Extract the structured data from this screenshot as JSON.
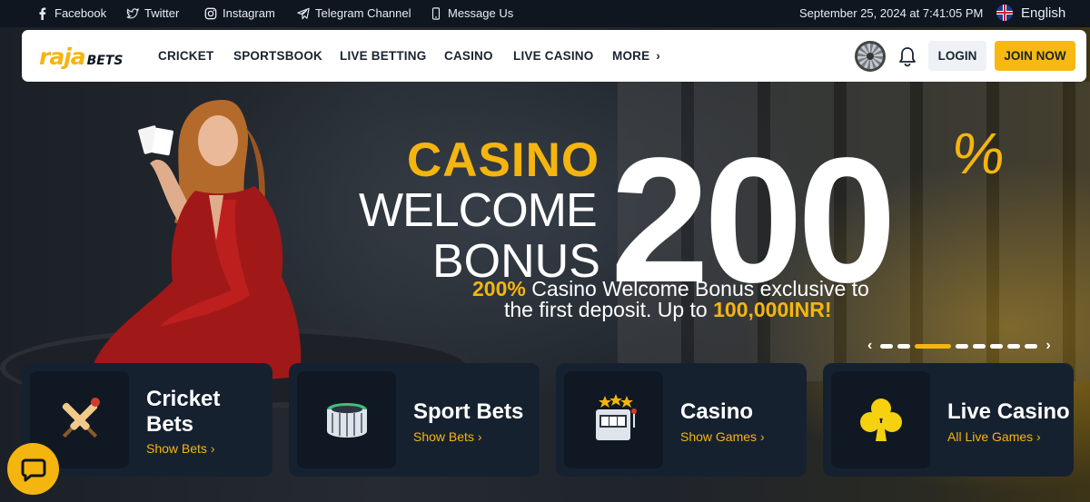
{
  "topbar": {
    "social": [
      {
        "label": "Facebook",
        "icon": "facebook-icon"
      },
      {
        "label": "Twitter",
        "icon": "twitter-icon"
      },
      {
        "label": "Instagram",
        "icon": "instagram-icon"
      },
      {
        "label": "Telegram Channel",
        "icon": "telegram-icon"
      },
      {
        "label": "Message Us",
        "icon": "phone-icon"
      }
    ],
    "datetime": "September 25, 2024 at 7:41:05 PM",
    "language": "English"
  },
  "nav": {
    "logo_main": "raja",
    "logo_sub": "BETS",
    "items": [
      "CRICKET",
      "SPORTSBOOK",
      "LIVE BETTING",
      "CASINO",
      "LIVE CASINO",
      "MORE"
    ],
    "login": "LOGIN",
    "join": "JOIN NOW"
  },
  "hero": {
    "line1": "CASINO",
    "line2": "WELCOME",
    "line3": "BONUS",
    "big_number": "200",
    "percent": "%",
    "sub_highlight1": "200%",
    "sub_text1": " Casino Welcome Bonus exclusive to",
    "sub_text2": "the first deposit. Up to ",
    "sub_highlight2": "100,000INR!",
    "slides_total": 8,
    "slide_active": 3
  },
  "cards": [
    {
      "title_line1": "Cricket",
      "title_line2": "Bets",
      "link": "Show Bets",
      "icon": "cricket-bats-icon"
    },
    {
      "title_line1": "Sport Bets",
      "title_line2": "",
      "link": "Show Bets",
      "icon": "stadium-icon"
    },
    {
      "title_line1": "Casino",
      "title_line2": "",
      "link": "Show Games",
      "icon": "slot-machine-icon"
    },
    {
      "title_line1": "Live Casino",
      "title_line2": "",
      "link": "All Live Games",
      "icon": "club-icon"
    }
  ],
  "colors": {
    "accent": "#f5b50f",
    "dark": "#121922",
    "card": "#162130"
  }
}
